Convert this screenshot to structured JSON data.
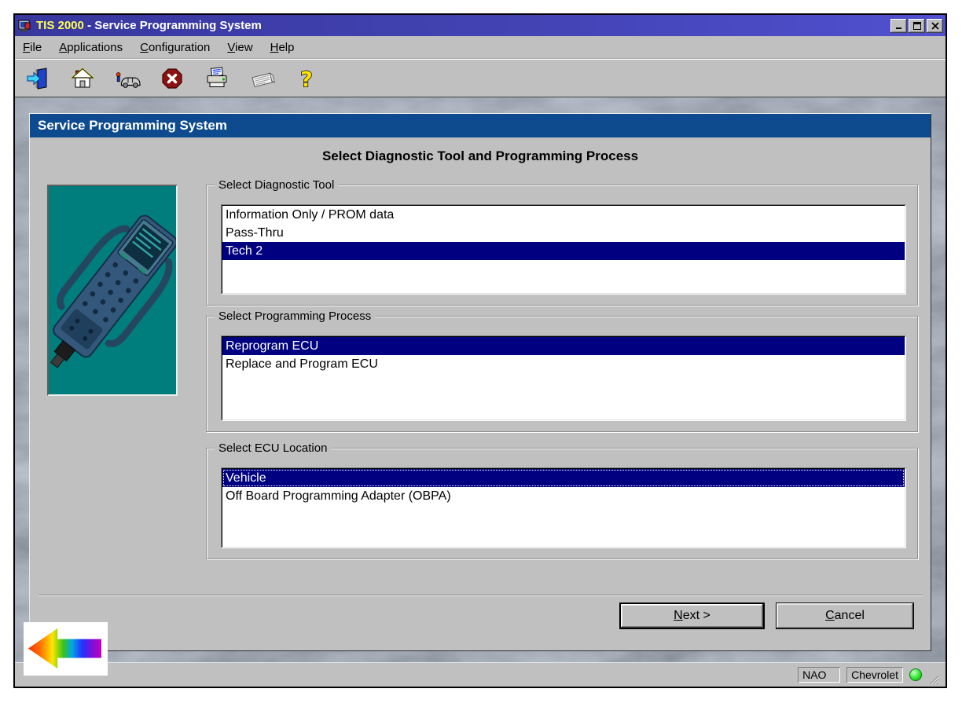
{
  "window": {
    "title_app": "TIS 2000",
    "title_rest": " - Service Programming System",
    "controls": [
      "minimize",
      "maximize",
      "close"
    ]
  },
  "menu": {
    "items": [
      "File",
      "Applications",
      "Configuration",
      "View",
      "Help"
    ]
  },
  "toolbar": {
    "icons": [
      "exit-icon",
      "home-icon",
      "vehicle-select-icon",
      "stop-icon",
      "print-icon",
      "documentation-icon",
      "help-icon"
    ],
    "help_glyph": "?"
  },
  "panel": {
    "title": "Service Programming System",
    "heading": "Select Diagnostic Tool and Programming Process",
    "groups": [
      {
        "label": "Select Diagnostic Tool",
        "items": [
          "Information Only / PROM data",
          "Pass-Thru",
          "Tech 2"
        ],
        "selected_index": 2,
        "focused": false
      },
      {
        "label": "Select Programming Process",
        "items": [
          "Reprogram ECU",
          "Replace and Program ECU"
        ],
        "selected_index": 0,
        "focused": false
      },
      {
        "label": "Select ECU Location",
        "items": [
          "Vehicle",
          "Off Board Programming Adapter (OBPA)"
        ],
        "selected_index": 0,
        "focused": true
      }
    ],
    "buttons": {
      "next": "Next >",
      "cancel": "Cancel"
    }
  },
  "statusbar": {
    "fields": [
      "NAO",
      "Chevrolet"
    ],
    "indicator": "green-online"
  },
  "colors": {
    "selection": "#000080",
    "panel_titlebar": "#0d4a8e",
    "image_background": "#007d7d",
    "titlebar_gradient_left": "#38379e",
    "titlebar_gradient_right": "#5150d0",
    "marble_base": "#8696b0"
  }
}
